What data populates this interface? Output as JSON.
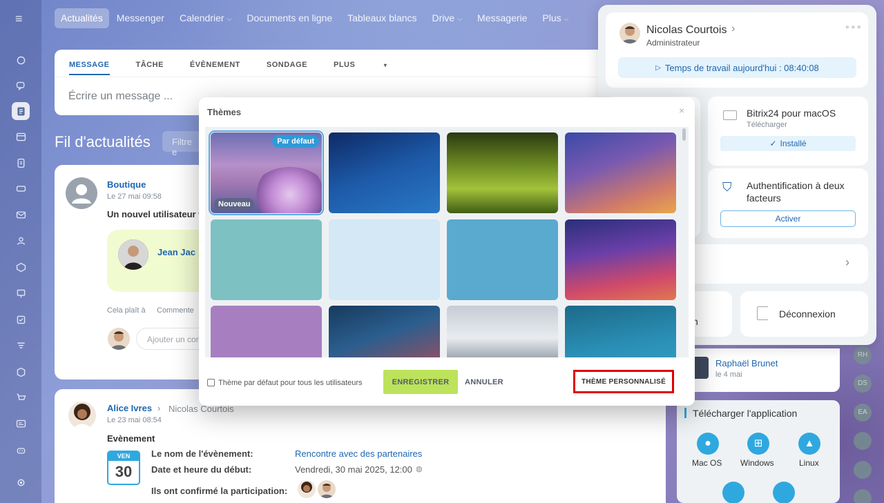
{
  "nav": {
    "tabs": [
      {
        "label": "Actualités"
      },
      {
        "label": "Messenger"
      },
      {
        "label": "Calendrier"
      },
      {
        "label": "Documents en ligne"
      },
      {
        "label": "Tableaux blancs"
      },
      {
        "label": "Drive"
      },
      {
        "label": "Messagerie"
      },
      {
        "label": "Plus"
      }
    ]
  },
  "composer": {
    "tabs": [
      "MESSAGE",
      "TÂCHE",
      "ÉVÈNEMENT",
      "SONDAGE",
      "PLUS"
    ],
    "placeholder": "Écrire un message ..."
  },
  "feed": {
    "title": "Fil d'actualités",
    "filter_placeholder": "Filtre e"
  },
  "post1": {
    "author": "Boutique",
    "date": "Le 27 mai 09:58",
    "text": "Un nouvel utilisateur v",
    "mention": "Jean Jac",
    "like": "Cela plaît à",
    "comment": "Commente",
    "comment_placeholder": "Ajouter un com"
  },
  "post2": {
    "author": "Alice Ivres",
    "recipient": "Nicolas Courtois",
    "date": "Le 23 mai 08:54",
    "type": "Evènement",
    "cal_day_name": "VEN",
    "cal_day": "30",
    "name_label": "Le nom de l'évènement:",
    "name_value": "Rencontre avec des partenaires",
    "start_label": "Date et heure du début:",
    "start_value": "Vendredi, 30 mai 2025, 12:00",
    "confirmed_label": "Ils ont confirmé la participation:"
  },
  "profile": {
    "name": "Nicolas Courtois",
    "role": "Administrateur",
    "worktime": "Temps de travail aujourd'hui : 08:40:08",
    "macos_title": "Bitrix24 pour macOS",
    "macos_sub": "Télécharger",
    "macos_btn": "Installé",
    "twofa_title": "Authentification à deux facteurs",
    "twofa_btn": "Activer",
    "partial_left": "n",
    "logout": "Déconnexion"
  },
  "sidebar_right": {
    "user": "Raphaël Brunet",
    "user_date": "le 4 mai",
    "download_title": "Télécharger l'application",
    "apps": [
      "Mac OS",
      "Windows",
      "Linux"
    ],
    "mini_avatars": [
      "RH",
      "DS",
      "EA"
    ]
  },
  "themes_modal": {
    "title": "Thèmes",
    "badge_default": "Par défaut",
    "badge_new": "Nouveau",
    "checkbox_label": "Thème par défaut pour tous les utilisateurs",
    "save": "ENREGISTRER",
    "cancel": "ANNULER",
    "custom": "THÈME PERSONNALISÉ",
    "highlight_color": "#e00000",
    "save_color": "#bde25b"
  }
}
